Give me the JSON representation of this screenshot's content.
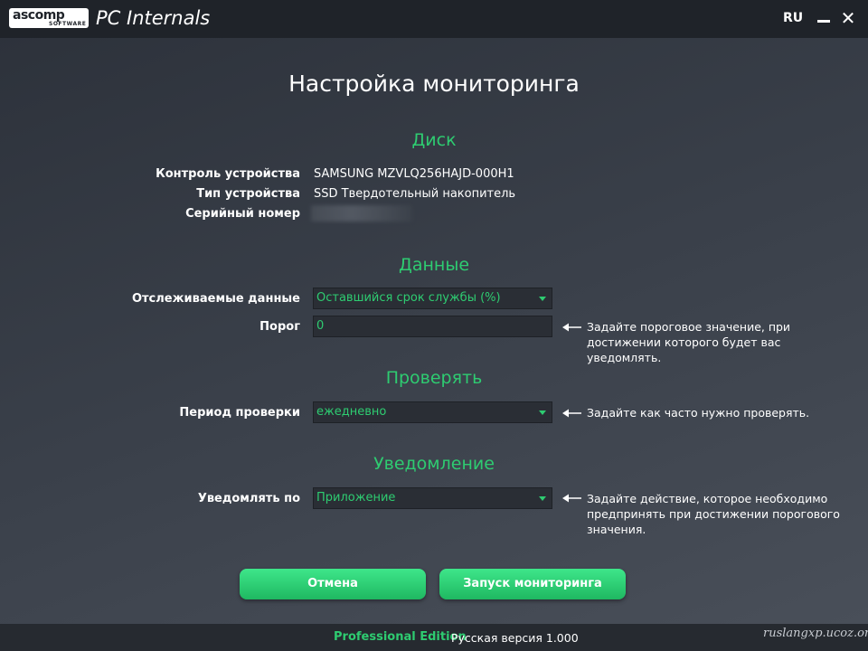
{
  "titlebar": {
    "logo_text": "ascomp",
    "logo_sub": "SOFTWARE",
    "app_title": "PC Internals",
    "language": "RU"
  },
  "page": {
    "title": "Настройка мониторинга"
  },
  "disk": {
    "section_title": "Диск",
    "device_label": "Контроль устройства",
    "device_value": "SAMSUNG MZVLQ256HAJD-000H1",
    "type_label": "Тип устройства",
    "type_value": "SSD Твердотельный накопитель",
    "serial_label": "Серийный номер",
    "serial_value": ""
  },
  "data_section": {
    "section_title": "Данные",
    "tracked_label": "Отслеживаемые данные",
    "tracked_value": "Оставшийся срок службы (%)",
    "threshold_label": "Порог",
    "threshold_value": "0",
    "threshold_hint": "Задайте пороговое значение, при достижении которого будет вас уведомлять."
  },
  "check_section": {
    "section_title": "Проверять",
    "period_label": "Период проверки",
    "period_value": "ежедневно",
    "period_hint": "Задайте как часто нужно проверять."
  },
  "notify_section": {
    "section_title": "Уведомление",
    "notify_label": "Уведомлять по",
    "notify_value": "Приложение",
    "notify_hint": "Задайте действие, которое необходимо предпринять при достижении порогового значения."
  },
  "buttons": {
    "cancel": "Отмена",
    "start": "Запуск мониторинга"
  },
  "footer": {
    "edition": "Professional Edition",
    "version": "Русская версия 1.000",
    "watermark": "ruslangxp.ucoz.org"
  },
  "colors": {
    "accent": "#2ecc71",
    "titlebar": "#1f2329",
    "field_bg": "#2a2e35"
  }
}
